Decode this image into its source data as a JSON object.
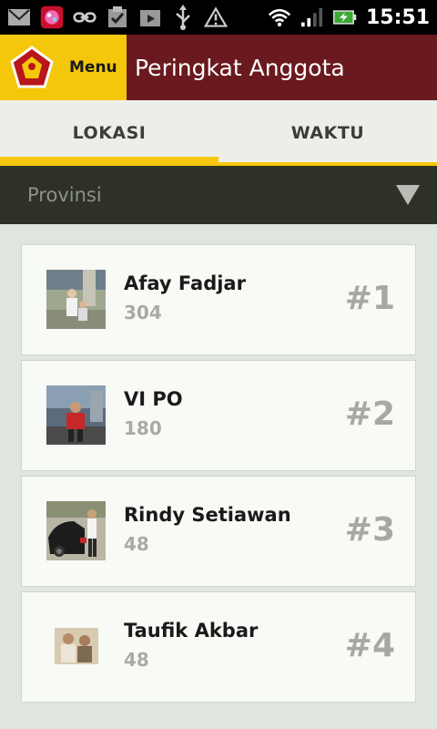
{
  "status_bar": {
    "time": "15:51",
    "icons": [
      "gmail-icon",
      "candy-crush-icon",
      "link-icon",
      "clipboard-check-icon",
      "play-store-icon",
      "usb-icon",
      "warning-icon",
      "wifi-icon",
      "signal-icon",
      "battery-charging-icon"
    ]
  },
  "app_bar": {
    "menu_label": "Menu",
    "title": "Peringkat Anggota"
  },
  "tabs": [
    {
      "label": "LOKASI",
      "selected": true
    },
    {
      "label": "WAKTU",
      "selected": false
    }
  ],
  "filter": {
    "province_placeholder": "Provinsi"
  },
  "members": [
    {
      "name": "Afay Fadjar",
      "score": "304",
      "rank": "#1"
    },
    {
      "name": "VI PO",
      "score": "180",
      "rank": "#2"
    },
    {
      "name": "Rindy Setiawan",
      "score": "48",
      "rank": "#3"
    },
    {
      "name": "Taufik Akbar",
      "score": "48",
      "rank": "#4"
    }
  ],
  "colors": {
    "accent_yellow": "#f5c70a",
    "app_bar_maroon": "#6a1a1e",
    "filter_bar": "#2e3226"
  }
}
